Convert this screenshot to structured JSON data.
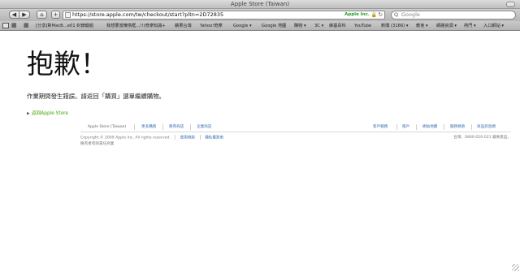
{
  "window": {
    "title": "Apple Store (Taiwan)"
  },
  "toolbar": {
    "back_icon": "◀",
    "forward_icon": "▶",
    "home_icon": "⌂",
    "add_icon": "+",
    "url": "https://store.apple.com/tw/checkout/start?pltn=2D72835",
    "cert_label": "Apple Inc.",
    "lock_icon": "🔒",
    "reload_icon": "↻",
    "search_icon": "Q",
    "search_placeholder": "Google"
  },
  "bookmarks": {
    "grid_icon": "▦",
    "grid2_icon": "▦",
    "items": [
      "[分享]對MacB…e01 封鎖鍵組",
      "我想要當懶惰框…!!(奇摩知識+",
      "蘋果台灣",
      "Yahoo!奇摩",
      "Google ▾",
      "Google 地圖",
      "購物 ▾",
      "3C ▾",
      "維基百科",
      "YouTube",
      "新聞 (3166) ▾",
      "教會 ▾",
      "網路資源 ▾",
      "熱門 ▾",
      "入口網站 ▾"
    ]
  },
  "page": {
    "heading": "抱歉！",
    "error_message": "作業期間發生錯誤。請返回「購買」選單繼續購物。",
    "back_arrow": "▶",
    "back_link": "返回Apple Store"
  },
  "footer": {
    "apple_icon": "",
    "store_name": "Apple Store (Taiwan)",
    "left_links": [
      "更多購買",
      "教育商店",
      "企業商店"
    ],
    "right_links": [
      "客戶服務",
      "帳戶",
      "網站地圖",
      "服務條款",
      "商品訊息網"
    ],
    "copyright": "Copyright © 2009 Apple Inc. All rights reserved.",
    "terms_link": "使用條款",
    "privacy_link": "隱私權政策",
    "info_line": "擁有者有限責任商業",
    "phone": "台灣：0800-020-021 蘋果產品。"
  }
}
